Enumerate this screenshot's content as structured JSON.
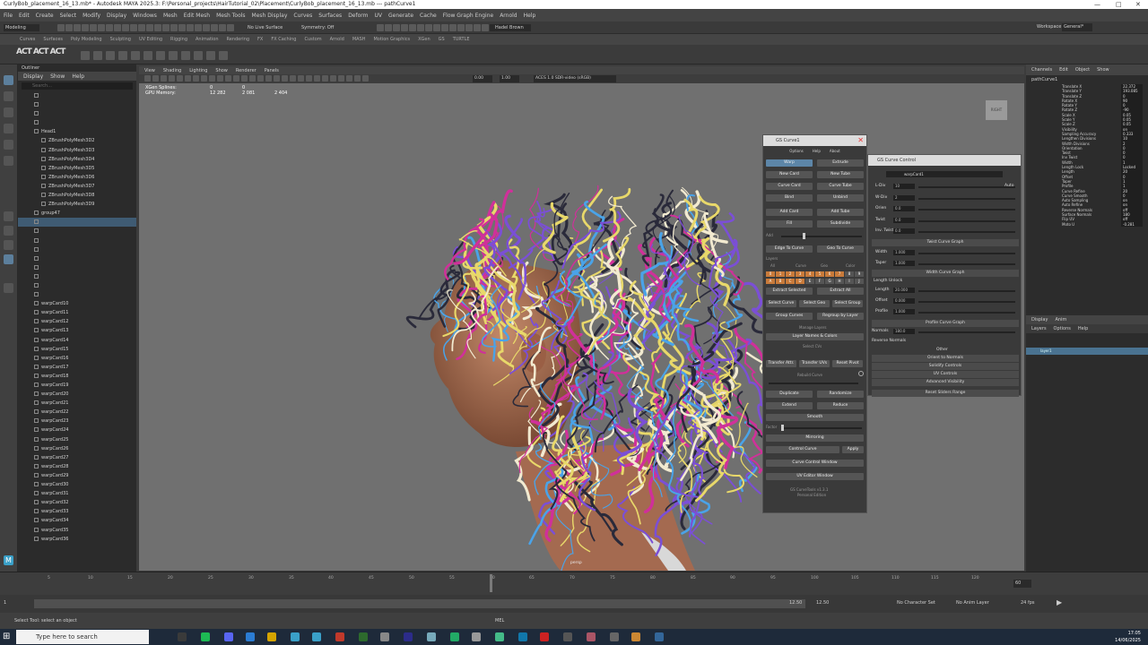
{
  "window": {
    "title": "CurlyBob_placement_16_13.mb* - Autodesk MAYA 2025.3: F:\\Personal_projects\\HairTutorial_02\\Placement\\CurlyBob_placement_16_13.mb --- pathCurve1",
    "menus": [
      "File",
      "Edit",
      "Create",
      "Select",
      "Modify",
      "Display",
      "Windows",
      "Mesh",
      "Edit Mesh",
      "Mesh Tools",
      "Mesh Display",
      "Curves",
      "Surfaces",
      "Deform",
      "UV",
      "Generate",
      "Cache",
      "Flow Graph Engine",
      "Arnold",
      "Help"
    ],
    "workspace_label": "Workspace:",
    "workspace_value": "General*",
    "user": "Hadel Brown",
    "live_surface": "No Live Surface",
    "symmetry": "Symmetry: Off",
    "mode": "Modeling"
  },
  "shelf_tabs": [
    "Curves",
    "Surfaces",
    "Poly Modeling",
    "Sculpting",
    "UV Editing",
    "Rigging",
    "Animation",
    "Rendering",
    "FX",
    "FX Caching",
    "Custom",
    "Arnold",
    "MASH",
    "Motion Graphics",
    "XGen",
    "GS",
    "TURTLE"
  ],
  "outliner": {
    "title": "Outliner",
    "menus": [
      "Display",
      "Show",
      "Help"
    ],
    "search_placeholder": "Search...",
    "items": [
      {
        "label": "",
        "level": 1,
        "selected": false
      },
      {
        "label": "",
        "level": 1,
        "selected": false
      },
      {
        "label": "",
        "level": 1,
        "selected": false
      },
      {
        "label": "",
        "level": 1,
        "selected": false
      },
      {
        "label": "Head1",
        "level": 1,
        "selected": false
      },
      {
        "label": "ZBrushPolyMesh3D2",
        "level": 2,
        "selected": false
      },
      {
        "label": "ZBrushPolyMesh3D3",
        "level": 2,
        "selected": false
      },
      {
        "label": "ZBrushPolyMesh3D4",
        "level": 2,
        "selected": false
      },
      {
        "label": "ZBrushPolyMesh3D5",
        "level": 2,
        "selected": false
      },
      {
        "label": "ZBrushPolyMesh3D6",
        "level": 2,
        "selected": false
      },
      {
        "label": "ZBrushPolyMesh3D7",
        "level": 2,
        "selected": false
      },
      {
        "label": "ZBrushPolyMesh3D8",
        "level": 2,
        "selected": false
      },
      {
        "label": "ZBrushPolyMesh3D9",
        "level": 2,
        "selected": false
      },
      {
        "label": "group47",
        "level": 1,
        "selected": false
      },
      {
        "label": "",
        "level": 1,
        "selected": true
      },
      {
        "label": "",
        "level": 1,
        "selected": false
      },
      {
        "label": "",
        "level": 1,
        "selected": false
      },
      {
        "label": "",
        "level": 1,
        "selected": false
      },
      {
        "label": "",
        "level": 1,
        "selected": false
      },
      {
        "label": "",
        "level": 1,
        "selected": false
      },
      {
        "label": "",
        "level": 1,
        "selected": false
      },
      {
        "label": "",
        "level": 1,
        "selected": false
      },
      {
        "label": "",
        "level": 1,
        "selected": false
      },
      {
        "label": "warpCard10",
        "level": 1,
        "selected": false
      },
      {
        "label": "warpCard11",
        "level": 1,
        "selected": false
      },
      {
        "label": "warpCard12",
        "level": 1,
        "selected": false
      },
      {
        "label": "warpCard13",
        "level": 1,
        "selected": false
      },
      {
        "label": "warpCard14",
        "level": 1,
        "selected": false
      },
      {
        "label": "warpCard15",
        "level": 1,
        "selected": false
      },
      {
        "label": "warpCard16",
        "level": 1,
        "selected": false
      },
      {
        "label": "warpCard17",
        "level": 1,
        "selected": false
      },
      {
        "label": "warpCard18",
        "level": 1,
        "selected": false
      },
      {
        "label": "warpCard19",
        "level": 1,
        "selected": false
      },
      {
        "label": "warpCard20",
        "level": 1,
        "selected": false
      },
      {
        "label": "warpCard21",
        "level": 1,
        "selected": false
      },
      {
        "label": "warpCard22",
        "level": 1,
        "selected": false
      },
      {
        "label": "warpCard23",
        "level": 1,
        "selected": false
      },
      {
        "label": "warpCard24",
        "level": 1,
        "selected": false
      },
      {
        "label": "warpCard25",
        "level": 1,
        "selected": false
      },
      {
        "label": "warpCard26",
        "level": 1,
        "selected": false
      },
      {
        "label": "warpCard27",
        "level": 1,
        "selected": false
      },
      {
        "label": "warpCard28",
        "level": 1,
        "selected": false
      },
      {
        "label": "warpCard29",
        "level": 1,
        "selected": false
      },
      {
        "label": "warpCard30",
        "level": 1,
        "selected": false
      },
      {
        "label": "warpCard31",
        "level": 1,
        "selected": false
      },
      {
        "label": "warpCard32",
        "level": 1,
        "selected": false
      },
      {
        "label": "warpCard33",
        "level": 1,
        "selected": false
      },
      {
        "label": "warpCard34",
        "level": 1,
        "selected": false
      },
      {
        "label": "warpCard35",
        "level": 1,
        "selected": false
      },
      {
        "label": "warpCard36",
        "level": 1,
        "selected": false
      }
    ]
  },
  "viewport": {
    "menus": [
      "View",
      "Shading",
      "Lighting",
      "Show",
      "Renderer",
      "Panels"
    ],
    "hud": [
      {
        "label": "XGen Splines:",
        "v1": "0",
        "v2": "0"
      },
      {
        "label": "GPU Memory:",
        "v1": "12 282",
        "v2": "2 081",
        "v3": "2 404"
      }
    ],
    "colorspace": "ACES 1.0 SDR-video (sRGB)",
    "exposure": "0.00",
    "gamma": "1.00",
    "camera_label": "persp",
    "cube_label": "RIGHT"
  },
  "gs_curve": {
    "title": "GS Curve1",
    "tabs": [
      "Options",
      "Help",
      "About"
    ],
    "buttons": {
      "warp": "Warp",
      "extrude": "Extrude",
      "new_card": "New Card",
      "new_tube": "New Tube",
      "curve_card": "Curve Card",
      "curve_tube": "Curve Tube",
      "bind": "Bind",
      "unbind": "Unbind",
      "add_card": "Add Card",
      "add_tube": "Add Tube",
      "fill": "Fill",
      "subdivide": "Subdivide",
      "edge_to_curve": "Edge To Curve",
      "geo_to_curve": "Geo To Curve",
      "all": "All",
      "curve": "Curve",
      "geo": "Geo",
      "color": "Color",
      "extract_selected": "Extract Selected",
      "extract_all": "Extract All",
      "select_curve": "Select Curve",
      "select_geo": "Select Geo",
      "select_group": "Select Group",
      "group_curves": "Group Curves",
      "regroup_by_layer": "Regroup by Layer",
      "layer_names_colors": "Layer Names & Colors",
      "select_cvs": "Select CVs",
      "transfer_attr": "Transfer Attr.",
      "transfer_uvs": "Transfer UVs",
      "reset_pivot": "Reset Pivot",
      "rebuild_curve": "Rebuild Curve",
      "duplicate": "Duplicate",
      "randomize": "Randomize",
      "extend": "Extend",
      "reduce": "Reduce",
      "smooth": "Smooth",
      "mirroring": "Mirroring",
      "control_curve": "Control Curve",
      "apply": "Apply",
      "curve_control_window": "Curve Control Window",
      "uv_editor_window": "UV Editor Window"
    },
    "labels": {
      "add": "Add",
      "layers": "Layers",
      "factor": "Factor",
      "managing_layers": "Manage Layers"
    },
    "layer_digits": [
      "0",
      "1",
      "2",
      "3",
      "4",
      "5",
      "6",
      "7",
      "8",
      "9"
    ],
    "layer_letters": [
      "A",
      "B",
      "C",
      "D",
      "E",
      "F",
      "G",
      "H",
      "I",
      "J"
    ],
    "footer": "GS CurveTools v1.3.1",
    "footer2": "Personal Edition"
  },
  "gs_control": {
    "title": "GS Curve Control",
    "node": "warpCard1",
    "auto": "Auto",
    "rows": [
      {
        "label": "L-Div",
        "value": "10"
      },
      {
        "label": "W-Div",
        "value": "2"
      },
      {
        "label": "Orien",
        "value": "0.0"
      },
      {
        "label": "Twist",
        "value": "0.0"
      },
      {
        "label": "Inv. Twist",
        "value": "0.0"
      }
    ],
    "twist_graph": "Twist Curve Graph",
    "width": {
      "label": "Width",
      "value": "1.000"
    },
    "taper": {
      "label": "Taper",
      "value": "1.000"
    },
    "width_graph": "Width Curve Graph",
    "length_unlock": "Length Unlock",
    "length": {
      "label": "Length",
      "value": "20.000"
    },
    "offset": {
      "label": "Offset",
      "value": "0.000"
    },
    "profile": {
      "label": "Profile",
      "value": "1.000"
    },
    "profile_graph": "Profile Curve Graph",
    "normals": {
      "label": "Normals",
      "value": "180.0"
    },
    "reverse_normals": "Reverse Normals",
    "other": "Other",
    "orient_to_normals": "Orient to Normals",
    "solidify": "Solidify Controls",
    "uv_controls": "UV Controls",
    "adv_visibility": "Advanced Visibility",
    "reset_sliders": "Reset Sliders Range"
  },
  "channel_box": {
    "menus": [
      "Channels",
      "Edit",
      "Object",
      "Show"
    ],
    "object": "pathCurve1",
    "channels": [
      {
        "name": "Translate X",
        "value": "22.372"
      },
      {
        "name": "Translate Y",
        "value": "193.085"
      },
      {
        "name": "Translate Z",
        "value": "0"
      },
      {
        "name": "Rotate X",
        "value": "90"
      },
      {
        "name": "Rotate Y",
        "value": "0"
      },
      {
        "name": "Rotate Z",
        "value": "-90"
      },
      {
        "name": "Scale X",
        "value": "0.05"
      },
      {
        "name": "Scale Y",
        "value": "0.05"
      },
      {
        "name": "Scale Z",
        "value": "0.05"
      },
      {
        "name": "Visibility",
        "value": "on"
      },
      {
        "name": "Sampling Accuracy",
        "value": "0.333"
      },
      {
        "name": "Lengthen Divisions",
        "value": "10"
      },
      {
        "name": "Width Divisions",
        "value": "2"
      },
      {
        "name": "Orientation",
        "value": "0"
      },
      {
        "name": "Twist",
        "value": "0"
      },
      {
        "name": "Inv Twist",
        "value": "0"
      },
      {
        "name": "Width",
        "value": "1"
      },
      {
        "name": "Length Lock",
        "value": "Locked"
      },
      {
        "name": "Length",
        "value": "20"
      },
      {
        "name": "Offset",
        "value": "0"
      },
      {
        "name": "Taper",
        "value": "1"
      },
      {
        "name": "Profile",
        "value": "1"
      },
      {
        "name": "Curve Refine",
        "value": "20"
      },
      {
        "name": "Curve Smooth",
        "value": "0"
      },
      {
        "name": "Auto Sampling",
        "value": "on"
      },
      {
        "name": "Auto Refine",
        "value": "on"
      },
      {
        "name": "Reverse Normals",
        "value": "off"
      },
      {
        "name": "Surface Normals",
        "value": "180"
      },
      {
        "name": "Flip UV",
        "value": "off"
      },
      {
        "name": "Moto U",
        "value": "-0.281"
      }
    ]
  },
  "layers_panel": {
    "tabs": [
      "Display",
      "Anim"
    ],
    "menus": [
      "Layers",
      "Options",
      "Help"
    ],
    "layer": "layer1"
  },
  "timeline": {
    "ticks": [
      "5",
      "10",
      "15",
      "20",
      "25",
      "30",
      "35",
      "40",
      "45",
      "50",
      "55",
      "60",
      "65",
      "70",
      "75",
      "80",
      "85",
      "90",
      "95",
      "100",
      "105",
      "110",
      "115",
      "120"
    ],
    "current": "60",
    "start": "1",
    "end": "120",
    "range_start": "1",
    "range_end": "120",
    "anim_end": "12.50",
    "anim_end2": "12.50",
    "character_set": "No Character Set",
    "anim_layer": "No Anim Layer",
    "fps": "24 fps"
  },
  "command_line": {
    "status": "Select Tool: select an object",
    "mel": "MEL"
  },
  "taskbar": {
    "search": "Type here to search",
    "time": "17:05",
    "date": "14/06/2025"
  },
  "hair_colors": [
    "#e8d86a",
    "#7b4fd6",
    "#4aa3e8",
    "#d0309a",
    "#f2ead0",
    "#2a2a3a"
  ]
}
